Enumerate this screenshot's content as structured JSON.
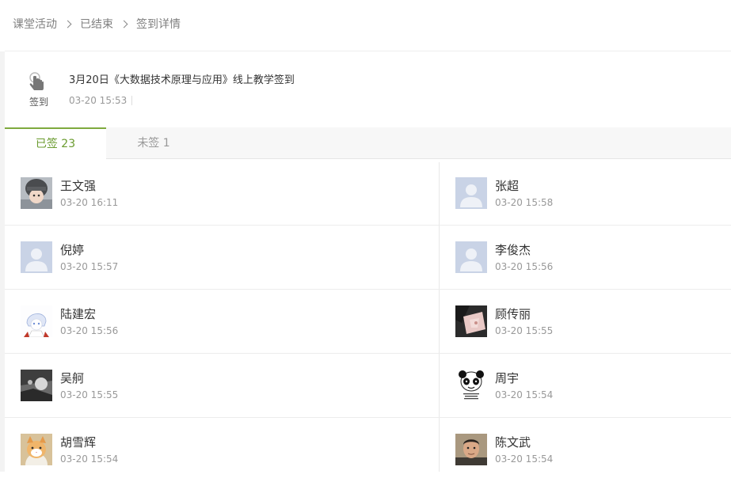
{
  "breadcrumb": [
    "课堂活动",
    "已结束",
    "签到详情"
  ],
  "activity": {
    "type_label": "签到",
    "title": "3月20日《大数据技术原理与应用》线上教学签到",
    "time": "03-20 15:53"
  },
  "tabs": {
    "signed": "已签 23",
    "unsigned": "未签 1"
  },
  "students": [
    {
      "name": "王文强",
      "time": "03-20 16:11",
      "avatar": "photo-winter-hat"
    },
    {
      "name": "张超",
      "time": "03-20 15:58",
      "avatar": "default-avatar"
    },
    {
      "name": "倪婷",
      "time": "03-20 15:57",
      "avatar": "default-avatar"
    },
    {
      "name": "李俊杰",
      "time": "03-20 15:56",
      "avatar": "default-avatar"
    },
    {
      "name": "陆建宏",
      "time": "03-20 15:56",
      "avatar": "anime-sketch"
    },
    {
      "name": "顾传丽",
      "time": "03-20 15:55",
      "avatar": "pink-artwork"
    },
    {
      "name": "吴舸",
      "time": "03-20 15:55",
      "avatar": "grayscale-photo"
    },
    {
      "name": "周宇",
      "time": "03-20 15:54",
      "avatar": "panda-meme"
    },
    {
      "name": "胡雪辉",
      "time": "03-20 15:54",
      "avatar": "cat-photo"
    },
    {
      "name": "陈文武",
      "time": "03-20 15:54",
      "avatar": "portrait-photo"
    }
  ],
  "colors": {
    "accent": "#6a9b2e",
    "default_avatar_bg": "#c9d3e6"
  }
}
